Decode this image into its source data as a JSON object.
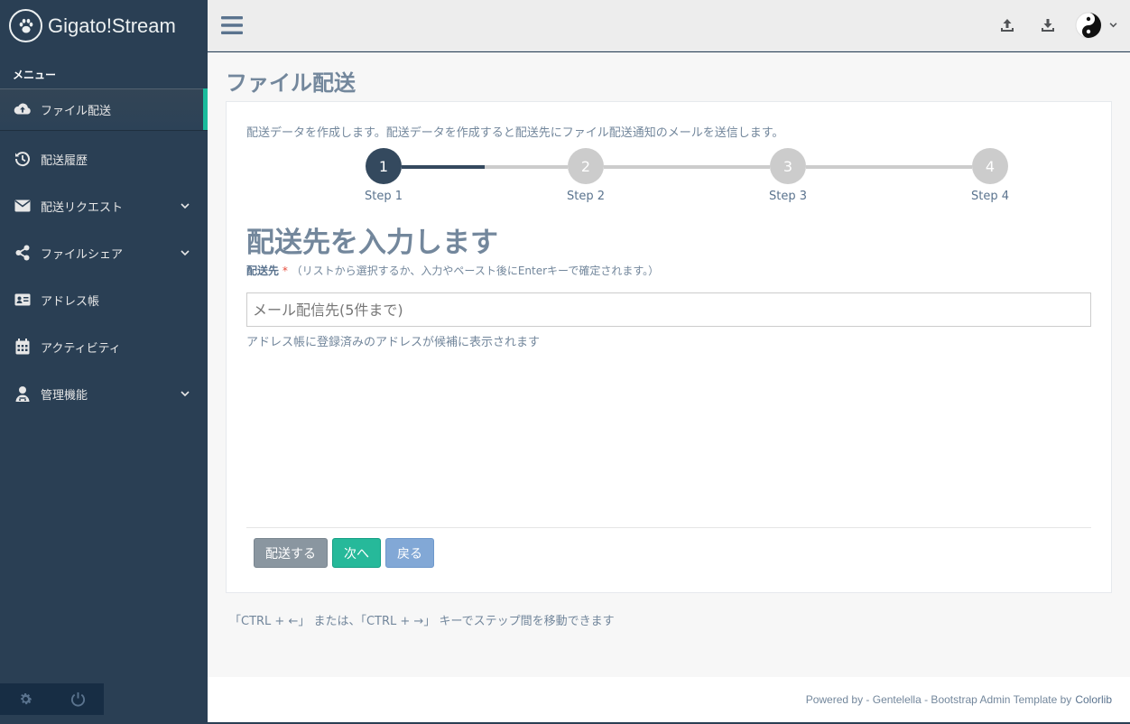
{
  "brand": {
    "name": "Gigato!Stream",
    "logo_icon": "paw-icon"
  },
  "sidebar": {
    "menu_title": "メニュー",
    "items": [
      {
        "label": "ファイル配送",
        "icon": "cloud-upload-icon",
        "active": true,
        "has_submenu": false
      },
      {
        "label": "配送履歴",
        "icon": "history-icon",
        "active": false,
        "has_submenu": false
      },
      {
        "label": "配送リクエスト",
        "icon": "envelope-icon",
        "active": false,
        "has_submenu": true
      },
      {
        "label": "ファイルシェア",
        "icon": "share-icon",
        "active": false,
        "has_submenu": true
      },
      {
        "label": "アドレス帳",
        "icon": "address-card-icon",
        "active": false,
        "has_submenu": false
      },
      {
        "label": "アクティビティ",
        "icon": "calendar-icon",
        "active": false,
        "has_submenu": false
      },
      {
        "label": "管理機能",
        "icon": "user-admin-icon",
        "active": false,
        "has_submenu": true
      }
    ],
    "footer_icons": [
      "gear-icon",
      "power-icon"
    ]
  },
  "topnav": {
    "icons": [
      "menu-icon",
      "upload-icon",
      "download-icon",
      "avatar",
      "chevron-down-icon"
    ]
  },
  "page": {
    "title": "ファイル配送",
    "intro": "配送データを作成します。配送データを作成すると配送先にファイル配送通知のメールを送信します。",
    "wizard": {
      "current_step": 1,
      "steps": [
        {
          "number": "1",
          "label": "Step 1"
        },
        {
          "number": "2",
          "label": "Step 2"
        },
        {
          "number": "3",
          "label": "Step 3"
        },
        {
          "number": "4",
          "label": "Step 4"
        }
      ]
    },
    "heading": "配送先を入力します",
    "field": {
      "label": "配送先",
      "required_mark": "*",
      "note": "（リストから選択するか、入力やペースト後にEnterキーで確定されます。）",
      "placeholder": "メール配信先(5件まで)",
      "value": "",
      "help": "アドレス帳に登録済みのアドレスが候補に表示されます"
    },
    "buttons": {
      "deliver": "配送する",
      "next": "次へ",
      "back": "戻る"
    },
    "hint": "「CTRL + ←」 または、「CTRL + →」 キーでステップ間を移動できます"
  },
  "footer": {
    "prefix": "Powered by - Gentelella - Bootstrap Admin Template by",
    "link": "Colorlib"
  },
  "colors": {
    "sidebar": "#2A3F54",
    "accent": "#1ABB9C",
    "next_button": "#26B99A",
    "back_button": "#82A8D6",
    "deliver_button": "#8A96A0",
    "wizard_active": "#34495E",
    "wizard_inactive": "#CCCCCC"
  }
}
